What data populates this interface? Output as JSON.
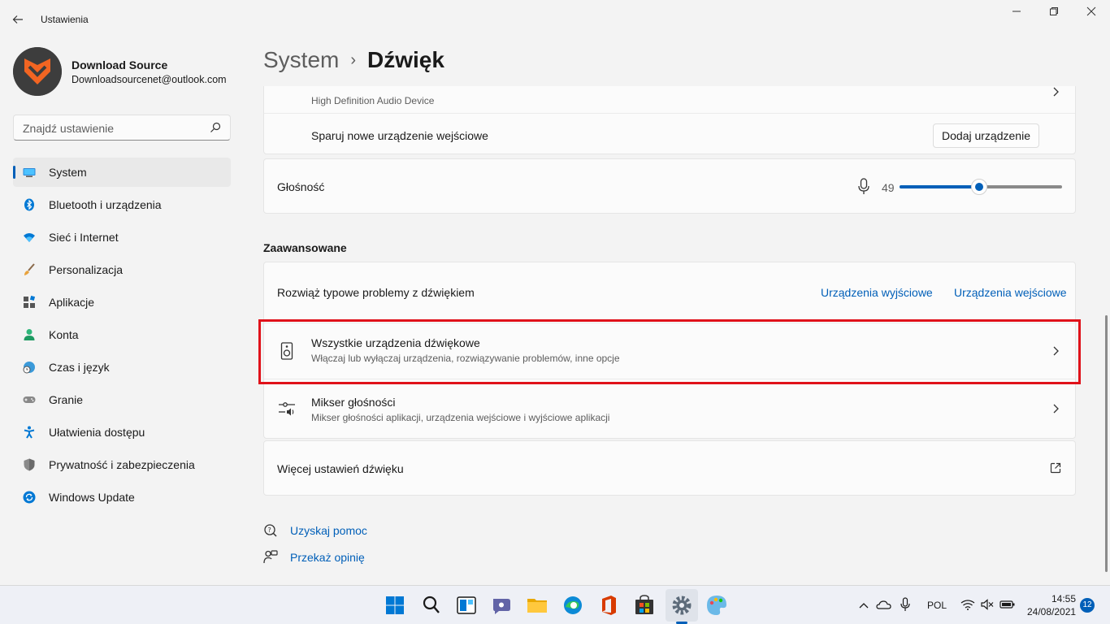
{
  "app": {
    "title": "Ustawienia"
  },
  "profile": {
    "name": "Download Source",
    "email": "Downloadsourcenet@outlook.com"
  },
  "search": {
    "placeholder": "Znajdź ustawienie"
  },
  "nav": {
    "items": [
      {
        "label": "System",
        "icon": "monitor-icon",
        "active": true
      },
      {
        "label": "Bluetooth i urządzenia",
        "icon": "bluetooth-icon"
      },
      {
        "label": "Sieć i Internet",
        "icon": "wifi-icon"
      },
      {
        "label": "Personalizacja",
        "icon": "brush-icon"
      },
      {
        "label": "Aplikacje",
        "icon": "apps-icon"
      },
      {
        "label": "Konta",
        "icon": "person-icon"
      },
      {
        "label": "Czas i język",
        "icon": "globe-clock-icon"
      },
      {
        "label": "Granie",
        "icon": "gamepad-icon"
      },
      {
        "label": "Ułatwienia dostępu",
        "icon": "accessibility-icon"
      },
      {
        "label": "Prywatność i zabezpieczenia",
        "icon": "shield-icon"
      },
      {
        "label": "Windows Update",
        "icon": "update-icon"
      }
    ]
  },
  "breadcrumb": {
    "parent": "System",
    "separator": "›",
    "current": "Dźwięk"
  },
  "input_device": {
    "subtitle": "High Definition Audio Device",
    "pair_label": "Sparuj nowe urządzenie wejściowe",
    "add_button": "Dodaj urządzenie"
  },
  "volume": {
    "label": "Głośność",
    "value": "49",
    "level_percent": 49
  },
  "advanced": {
    "title": "Zaawansowane",
    "troubleshoot": {
      "label": "Rozwiąż typowe problemy z dźwiękiem",
      "output_link": "Urządzenia wyjściowe",
      "input_link": "Urządzenia wejściowe"
    },
    "all_devices": {
      "title": "Wszystkie urządzenia dźwiękowe",
      "subtitle": "Włączaj lub wyłączaj urządzenia, rozwiązywanie problemów, inne opcje"
    },
    "mixer": {
      "title": "Mikser głośności",
      "subtitle": "Mikser głośności aplikacji, urządzenia wejściowe i wyjściowe aplikacji"
    },
    "more": {
      "label": "Więcej ustawień dźwięku"
    }
  },
  "help": {
    "get_help": "Uzyskaj pomoc",
    "feedback": "Przekaż opinię"
  },
  "taskbar": {
    "language": "POL",
    "time": "14:55",
    "date": "24/08/2021",
    "notifications": "12"
  },
  "colors": {
    "accent": "#005fb8",
    "highlight": "#e0121a"
  }
}
